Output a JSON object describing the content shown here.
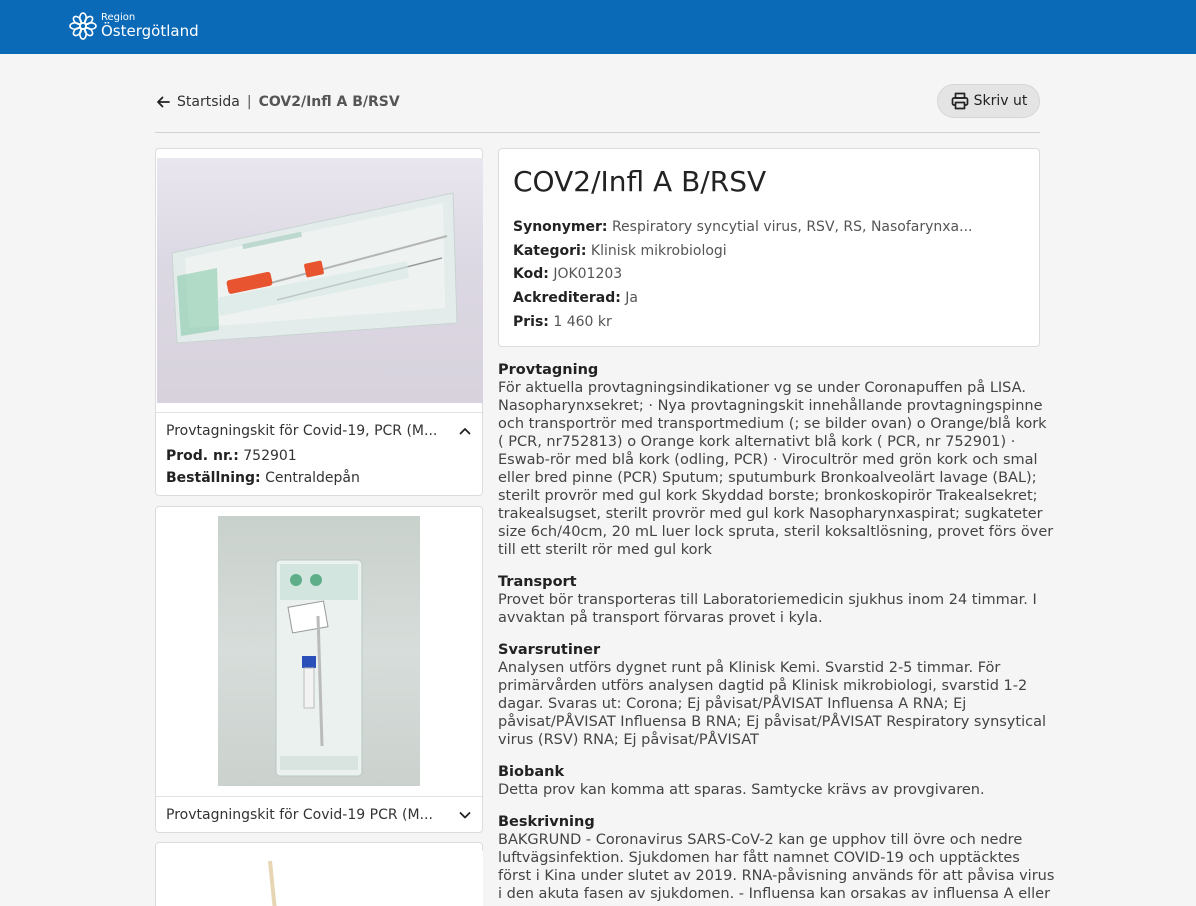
{
  "header": {
    "logo_small": "Region",
    "logo_big": "Östergötland",
    "brand_color": "#0a6ab8"
  },
  "breadcrumb": {
    "home": "Startsida",
    "separator": "|",
    "current": "COV2/Infl A B/RSV"
  },
  "print_button": {
    "label": "Skriv ut",
    "icon": "printer-icon"
  },
  "products": [
    {
      "title": "Provtagningskit för Covid-19, PCR (M...",
      "expanded": true,
      "prod_nr_label": "Prod. nr.",
      "prod_nr": "752901",
      "order_label": "Beställning",
      "order": "Centraldepån"
    },
    {
      "title": "Provtagningskit för Covid-19 PCR (M...",
      "expanded": false
    }
  ],
  "analysis": {
    "title": "COV2/Infl A B/RSV",
    "fields": [
      {
        "label": "Synonymer",
        "value": "Respiratory syncytial virus, RSV, RS, Nasofarynxa..."
      },
      {
        "label": "Kategori",
        "value": "Klinisk mikrobiologi"
      },
      {
        "label": "Kod",
        "value": "JOK01203"
      },
      {
        "label": "Ackrediterad",
        "value": "Ja"
      },
      {
        "label": "Pris",
        "value": "1 460 kr"
      }
    ]
  },
  "sections": [
    {
      "heading": "Provtagning",
      "lines": [
        "För aktuella provtagningsindikationer vg se under Coronapuffen på LISA.",
        "Nasopharynxsekret; · Nya provtagningskit innehållande provtagningspinne",
        "och transportrör med transportmedium (; se bilder ovan) o Orange/blå kork",
        "( PCR, nr752813) o Orange kork alternativt blå kork ( PCR, nr 752901) ·",
        "Eswab-rör med blå kork (odling, PCR) · Virocultrör med grön kork och smal",
        "eller bred pinne (PCR) Sputum; sputumburk Bronkoalveolärt lavage (BAL);",
        "sterilt provrör med gul kork Skyddad borste; bronkoskopirör Trakealsekret;",
        "trakealsugset, sterilt provrör med gul kork Nasopharynxaspirat; sugkateter",
        "size 6ch/40cm, 20 mL luer lock spruta, steril koksaltlösning, provet förs över",
        "till ett sterilt rör med gul kork"
      ]
    },
    {
      "heading": "Transport",
      "lines": [
        "Provet bör transporteras till Laboratoriemedicin sjukhus inom 24 timmar. I",
        "avvaktan på transport förvaras provet i kyla."
      ]
    },
    {
      "heading": "Svarsrutiner",
      "lines": [
        "Analysen utförs dygnet runt på Klinisk Kemi. Svarstid 2-5 timmar. För",
        "primärvården utförs analysen dagtid på Klinisk mikrobiologi, svarstid 1-2",
        "dagar. Svaras ut: Corona; Ej påvisat/PÅVISAT Influensa A RNA; Ej",
        "påvisat/PÅVISAT Influensa B RNA; Ej påvisat/PÅVISAT Respiratory synsytical",
        "virus (RSV) RNA; Ej påvisat/PÅVISAT"
      ]
    },
    {
      "heading": "Biobank",
      "lines": [
        "Detta prov kan komma att sparas. Samtycke krävs av provgivaren."
      ]
    },
    {
      "heading": "Beskrivning",
      "lines": [
        "BAKGRUND - Coronavirus SARS-CoV-2 kan ge upphov till övre och nedre",
        "luftvägsinfektion. Sjukdomen har fått namnet COVID-19 och upptäcktes",
        "först i Kina under slutet av 2019. RNA-påvisning används för att påvisa virus",
        "i den akuta fasen av sjukdomen. - Influensa kan orsakas av influensa A eller"
      ]
    }
  ]
}
